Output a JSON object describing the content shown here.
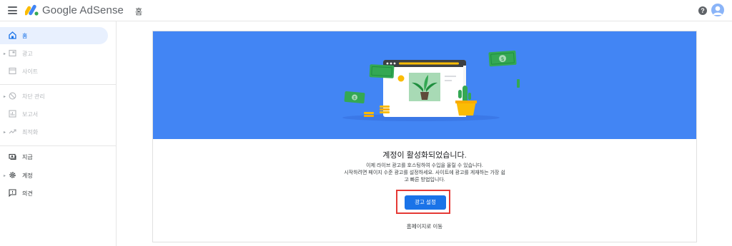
{
  "app": {
    "brand": "Google AdSense",
    "page_crumb": "홈"
  },
  "sidebar": {
    "items": [
      {
        "label": "홈"
      },
      {
        "label": "광고"
      },
      {
        "label": "사이트"
      },
      {
        "label": "차단 관리"
      },
      {
        "label": "보고서"
      },
      {
        "label": "최적화"
      },
      {
        "label": "지급"
      },
      {
        "label": "계정"
      },
      {
        "label": "의견"
      }
    ]
  },
  "main": {
    "headline": "계정이 활성화되었습니다.",
    "description_line1": "이제 라이브 광고를 호스팅하여 수입을 올릴 수 있습니다.",
    "description_line2": "시작하려면 페이지 수준 광고를 설정하세요. 사이트에 광고를 게재하는 가장 쉽",
    "description_line3": "고 빠른 방법입니다.",
    "primary_button": "광고 설정",
    "home_link": "홈페이지로 이동"
  },
  "colors": {
    "accent": "#1a73e8",
    "hero": "#4285f4",
    "highlight": "#e53935",
    "money": "#34a853"
  }
}
